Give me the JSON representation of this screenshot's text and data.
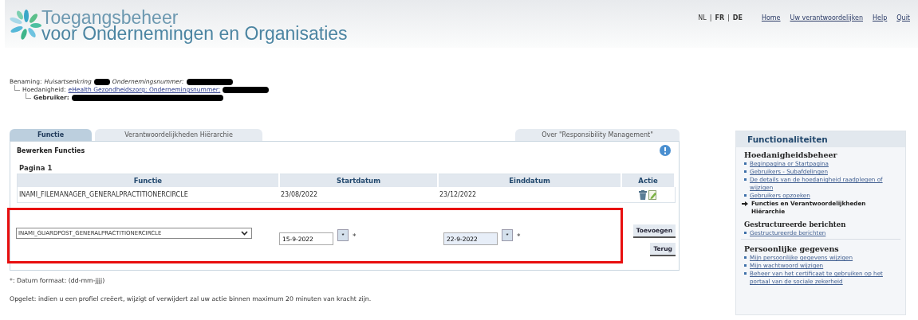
{
  "header": {
    "title_line1": "Toegangsbeheer",
    "title_line2": "voor Ondernemingen en Organisaties",
    "language_separator": "|",
    "languages": [
      {
        "label": "NL",
        "selected": true
      },
      {
        "label": "FR",
        "selected": false
      },
      {
        "label": "DE",
        "selected": false
      }
    ],
    "nav_links": [
      "Home",
      "Uw verantwoordelijken",
      "Help",
      "Quit"
    ]
  },
  "breadcrumb": {
    "benaming_label": "Benaming:",
    "benaming_value": "Huisartsenkring",
    "ondernemingsnummer_label": "Ondernemingsnummer:",
    "hoedanigheid_label": "Hoedanigheid:",
    "hoedanigheid_link": "eHealth Gezondheidszorg: Ondernemingsnummer:",
    "gebruiker_label": "Gebruiker:"
  },
  "tabs": [
    {
      "label": "Functie",
      "selected": true
    },
    {
      "label": "Verantwoordelijkheden Hiërarchie",
      "selected": false
    },
    {
      "label": "Over \"Responsibility Management\"",
      "selected": false
    }
  ],
  "panel": {
    "title": "Bewerken Functies",
    "page_label": "Pagina 1",
    "table": {
      "columns": [
        "Functie",
        "Startdatum",
        "Einddatum",
        "Actie"
      ],
      "rows": [
        {
          "functie": "INAMI_FILEMANAGER_GENERALPRACTITIONERCIRCLE",
          "startdatum": "23/08/2022",
          "einddatum": "23/12/2022"
        }
      ]
    },
    "new_row": {
      "functie": "INAMI_GUARDPOST_GENERALPRACTITIONERCIRCLE",
      "startdatum": "15-9-2022",
      "einddatum": "22-9-2022",
      "required_mark": "*",
      "calendar_label": "*"
    },
    "buttons": [
      "Toevoegen",
      "Terug"
    ]
  },
  "notes": [
    "*: Datum formaat: (dd-mm-jjjj)",
    "Opgelet: indien u een profiel creëert, wijzigt of verwijdert zal uw actie binnen maximum 20 minuten van kracht zijn."
  ],
  "sidebar": {
    "title": "Functionaliteiten",
    "sections": [
      {
        "title": "Hoedanigheidsbeheer",
        "items": [
          {
            "label": "Beginpagina or Startpagina",
            "kind": "link"
          },
          {
            "label": "Gebruikers - Subafdelingen",
            "kind": "link"
          },
          {
            "label": "De details van de hoedanigheid raadplegen of wijzigen",
            "kind": "link"
          },
          {
            "label": "Gebruikers opzoeken",
            "kind": "link"
          },
          {
            "label": "Functies en Verantwoordelijkheden Hiërarchie",
            "kind": "current"
          }
        ]
      },
      {
        "title": "Gestructureerde berichten",
        "items": [
          {
            "label": "Gestructureerde berichten",
            "kind": "link"
          }
        ]
      },
      {
        "title": "Persoonlijke gegevens",
        "items": [
          {
            "label": "Mijn persoonlijke gegevens wijzigen",
            "kind": "link"
          },
          {
            "label": "Mijn wachtwoord wijzigen",
            "kind": "link"
          },
          {
            "label": "Beheer van het certificaat te gebruiken op het portaal van de sociale zekerheid",
            "kind": "link"
          }
        ]
      }
    ]
  }
}
